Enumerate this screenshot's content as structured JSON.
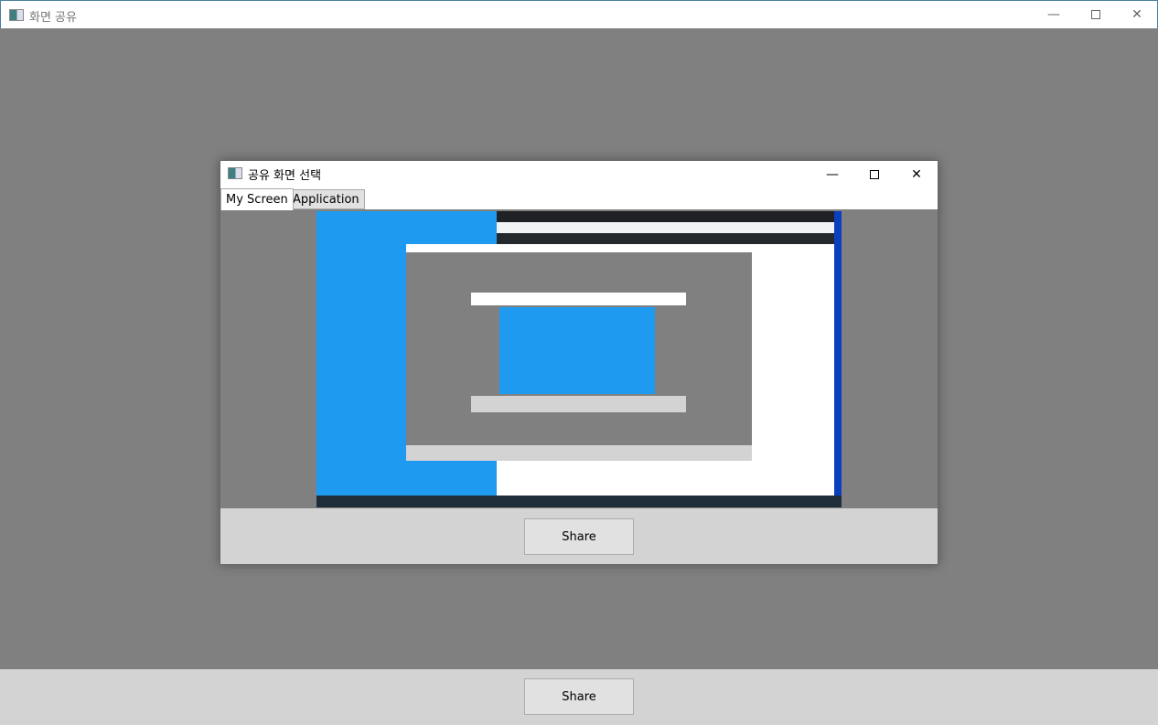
{
  "window": {
    "title": "화면 공유",
    "icon": "app-window-icon",
    "controls": [
      "minimize-icon",
      "maximize-icon",
      "close-icon"
    ]
  },
  "dialog": {
    "title": "공유 화면 선택",
    "tabs": [
      {
        "label": "My Screen",
        "selected": true
      },
      {
        "label": "Application",
        "selected": false
      }
    ],
    "share_label": "Share"
  },
  "footer": {
    "share_label": "Share"
  },
  "colors": {
    "desktop": "#1e9bf0",
    "background": "#808080",
    "footer": "#d3d3d3"
  }
}
